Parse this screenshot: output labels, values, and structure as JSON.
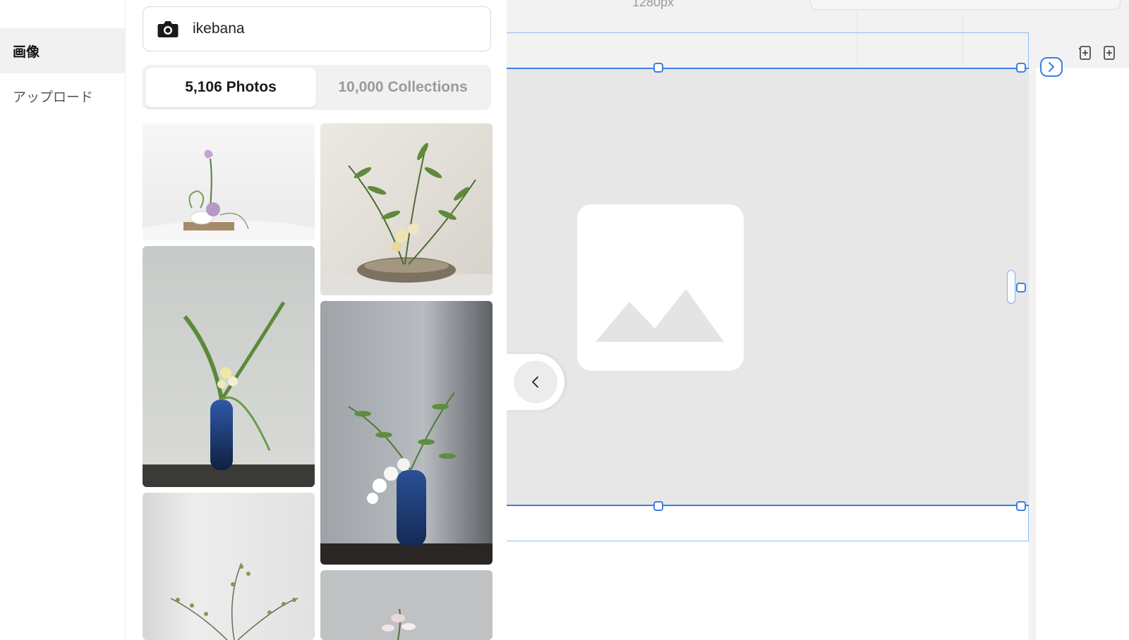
{
  "nav": {
    "items": [
      {
        "label": "画像",
        "active": true
      },
      {
        "label": "アップロード",
        "active": false
      }
    ]
  },
  "search": {
    "value": "ikebana",
    "icon": "camera-icon"
  },
  "tabs": {
    "photos": "5,106 Photos",
    "collections": "10,000 Collections"
  },
  "results": [
    {
      "subject": "lavender rose ikebana on wooden tray",
      "icon": "photo-thumbnail"
    },
    {
      "subject": "bamboo leaves in ceramic bowl",
      "icon": "photo-thumbnail"
    },
    {
      "subject": "narcissus in blue vase",
      "icon": "photo-thumbnail"
    },
    {
      "subject": "white orchid in blue vase",
      "icon": "photo-thumbnail"
    },
    {
      "subject": "branches in white room",
      "icon": "photo-thumbnail"
    },
    {
      "subject": "magnolia bud",
      "icon": "photo-thumbnail"
    }
  ],
  "canvas": {
    "ruler_label": "1280px",
    "placeholder_icon": "image-placeholder-icon",
    "accent": "#3d7fe0"
  }
}
